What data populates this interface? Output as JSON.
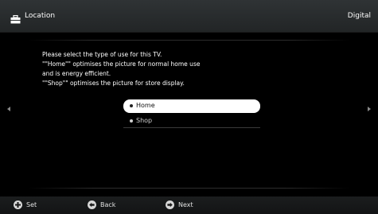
{
  "header": {
    "title": "Location",
    "title_icon": "toolbox-icon",
    "source": "Digital"
  },
  "instructions": {
    "lines": [
      "Please select the type of use for this TV.",
      "\"\"Home\"\" optimises the picture for normal home use",
      "and is energy efficient.",
      "\"\"Shop\"\" optimises the picture for store display."
    ]
  },
  "options": [
    {
      "label": "Home",
      "selected": true
    },
    {
      "label": "Shop",
      "selected": false
    }
  ],
  "footer": {
    "set_label": "Set",
    "set_icon": "plus-circle-icon",
    "back_label": "Back",
    "back_icon": "back-circle-icon",
    "next_label": "Next",
    "next_icon": "next-circle-icon"
  },
  "colors": {
    "header_bg": "#2a2d2f",
    "background": "#000000",
    "selected_bg": "#ffffff"
  }
}
